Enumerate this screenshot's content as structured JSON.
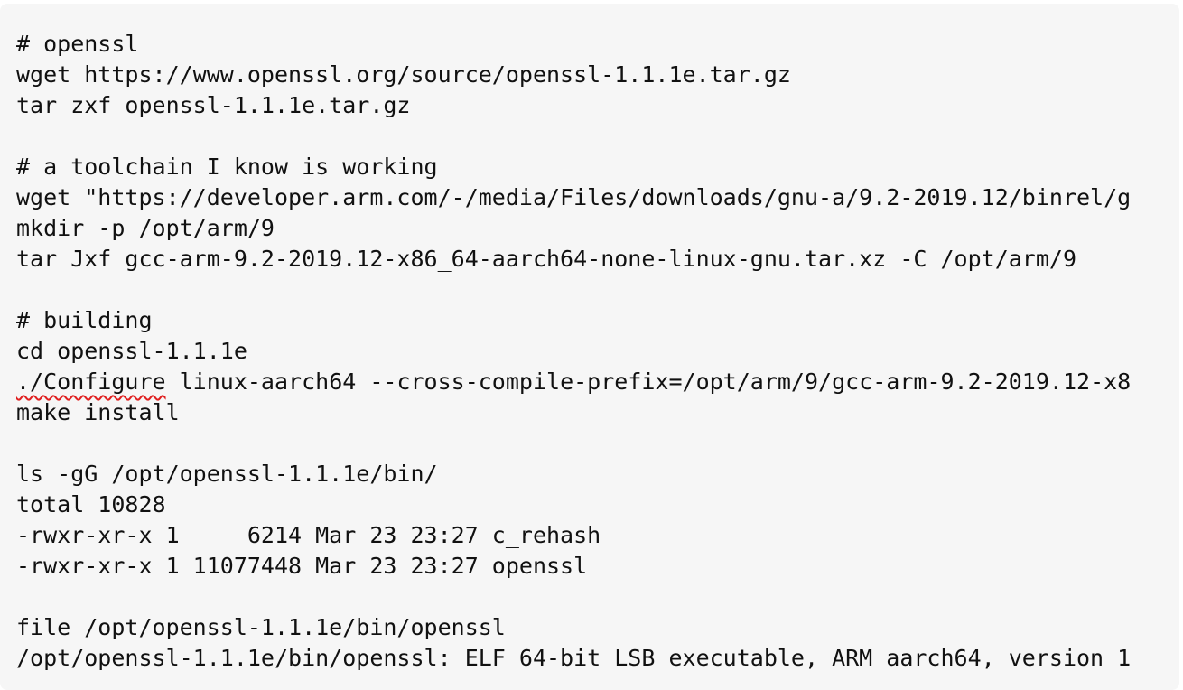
{
  "code_block": {
    "lines": [
      "# openssl",
      "wget https://www.openssl.org/source/openssl-1.1.1e.tar.gz",
      "tar zxf openssl-1.1.1e.tar.gz",
      "",
      "# a toolchain I know is working",
      "wget \"https://developer.arm.com/-/media/Files/downloads/gnu-a/9.2-2019.12/binrel/g",
      "mkdir -p /opt/arm/9",
      "tar Jxf gcc-arm-9.2-2019.12-x86_64-aarch64-none-linux-gnu.tar.xz -C /opt/arm/9",
      "",
      "# building",
      "cd openssl-1.1.1e",
      "",
      "make install",
      "",
      "ls -gG /opt/openssl-1.1.1e/bin/",
      "total 10828",
      "-rwxr-xr-x 1     6214 Mar 23 23:27 c_rehash",
      "-rwxr-xr-x 1 11077448 Mar 23 23:27 openssl",
      "",
      "file /opt/openssl-1.1.1e/bin/openssl",
      "/opt/openssl-1.1.1e/bin/openssl: ELF 64-bit LSB executable, ARM aarch64, version 1"
    ],
    "configure_line": {
      "flagged_text": "./Configure",
      "rest": " linux-aarch64 --cross-compile-prefix=/opt/arm/9/gcc-arm-9.2-2019.12-x8"
    }
  }
}
